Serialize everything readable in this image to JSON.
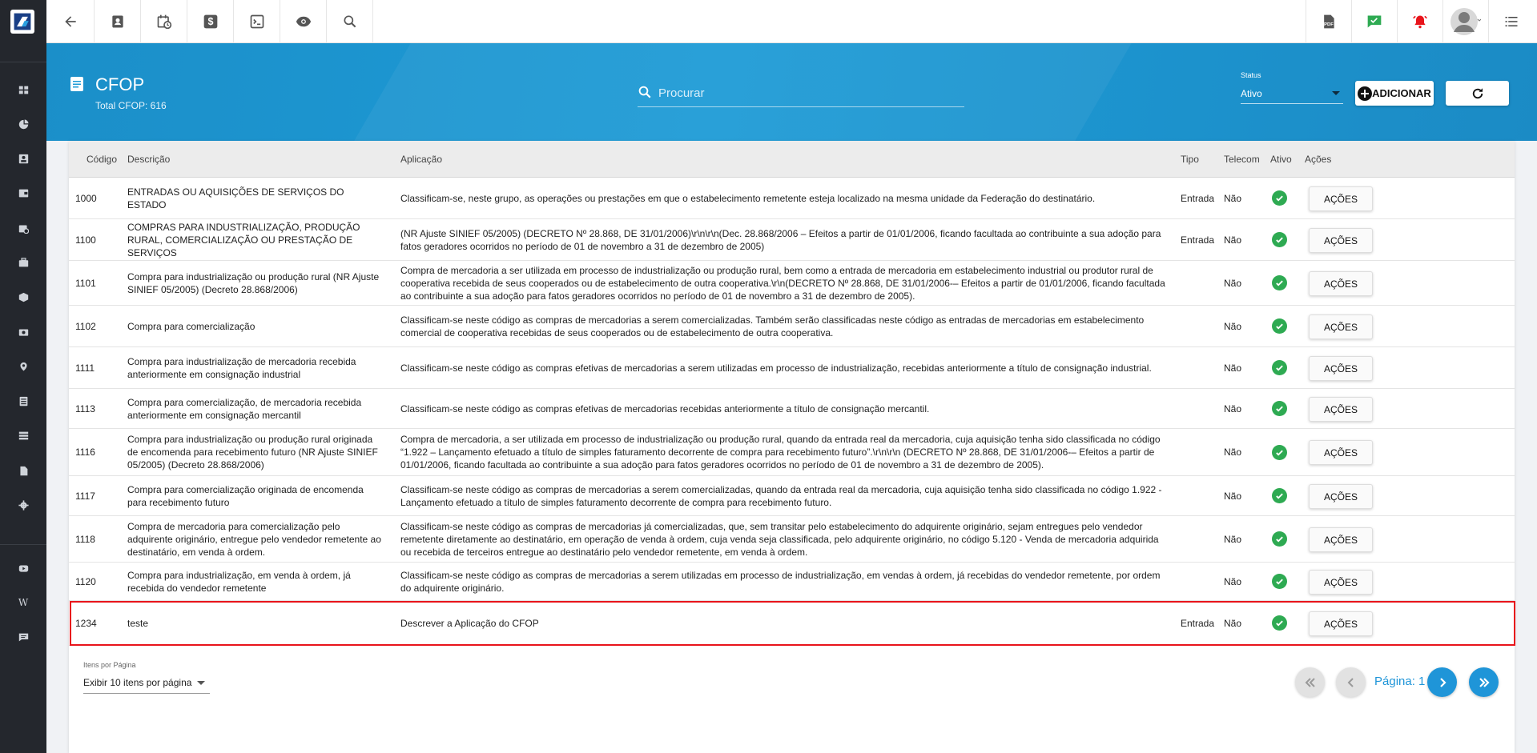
{
  "page": {
    "title": "CFOP",
    "total": "Total CFOP: 616"
  },
  "search": {
    "placeholder": "Procurar"
  },
  "status": {
    "label": "Status",
    "value": "Ativo"
  },
  "buttons": {
    "add": "ADICIONAR",
    "actions": "AÇÕES"
  },
  "table": {
    "headers": {
      "codigo": "Código",
      "descricao": "Descrição",
      "aplicacao": "Aplicação",
      "tipo": "Tipo",
      "telecom": "Telecom",
      "ativo": "Ativo",
      "acoes": "Ações"
    },
    "rows": [
      {
        "codigo": "1000",
        "descricao": "ENTRADAS OU AQUISIÇÕES DE SERVIÇOS DO ESTADO",
        "aplicacao": "Classificam-se, neste grupo, as operações ou prestações em que o estabelecimento remetente esteja localizado na mesma unidade da Federação do destinatário.",
        "tipo": "Entrada",
        "telecom": "Não"
      },
      {
        "codigo": "1100",
        "descricao": "COMPRAS PARA INDUSTRIALIZAÇÃO, PRODUÇÃO RURAL, COMERCIALIZAÇÃO OU PRESTAÇÃO DE SERVIÇOS",
        "aplicacao": "(NR Ajuste SINIEF 05/2005) (DECRETO Nº 28.868, DE 31/01/2006)\\r\\n\\r\\n(Dec. 28.868/2006 – Efeitos a partir de 01/01/2006, ficando facultada ao contribuinte a sua adoção para fatos geradores ocorridos no período de 01 de novembro a 31 de dezembro de 2005)",
        "tipo": "Entrada",
        "telecom": "Não"
      },
      {
        "codigo": "1101",
        "descricao": "Compra para industrialização ou produção rural (NR Ajuste SINIEF 05/2005) (Decreto 28.868/2006)",
        "aplicacao": "Compra de mercadoria a ser utilizada em processo de industrialização ou produção rural, bem como a entrada de mercadoria em estabelecimento industrial ou produtor rural de cooperativa recebida de seus cooperados ou de estabelecimento de outra cooperativa.\\r\\n(DECRETO Nº 28.868, DE 31/01/2006-– Efeitos a partir de 01/01/2006, ficando facultada ao contribuinte a sua adoção para fatos geradores ocorridos no período de 01 de novembro a 31 de dezembro de 2005).",
        "tipo": "",
        "telecom": "Não"
      },
      {
        "codigo": "1102",
        "descricao": "Compra para comercialização",
        "aplicacao": "Classificam-se neste código as compras de mercadorias a serem comercializadas. Também serão classificadas neste código as entradas de mercadorias em estabelecimento comercial de cooperativa recebidas de seus cooperados ou de estabelecimento de outra cooperativa.",
        "tipo": "",
        "telecom": "Não"
      },
      {
        "codigo": "1111",
        "descricao": "Compra para industrialização de mercadoria recebida anteriormente em consignação industrial",
        "aplicacao": "Classificam-se neste código as compras efetivas de mercadorias a serem utilizadas em processo de industrialização, recebidas anteriormente a título de consignação industrial.",
        "tipo": "",
        "telecom": "Não"
      },
      {
        "codigo": "1113",
        "descricao": "Compra para comercialização, de mercadoria recebida anteriormente em consignação mercantil",
        "aplicacao": "Classificam-se neste código as compras efetivas de mercadorias recebidas anteriormente a título de consignação mercantil.",
        "tipo": "",
        "telecom": "Não"
      },
      {
        "codigo": "1116",
        "descricao": "Compra para industrialização ou produção rural originada de encomenda para recebimento futuro (NR Ajuste SINIEF 05/2005) (Decreto 28.868/2006)",
        "aplicacao": "Compra de mercadoria, a ser utilizada em processo de industrialização ou produção rural, quando da entrada real da mercadoria, cuja aquisição tenha sido classificada no código “1.922 – Lançamento efetuado a título de simples faturamento decorrente de compra para recebimento futuro”.\\r\\n\\r\\n (DECRETO Nº 28.868, DE 31/01/2006-– Efeitos a partir de 01/01/2006, ficando facultada ao contribuinte a sua adoção para fatos geradores ocorridos no período de 01 de novembro a 31 de dezembro de 2005).",
        "tipo": "",
        "telecom": "Não"
      },
      {
        "codigo": "1117",
        "descricao": "Compra para comercialização originada de encomenda para recebimento futuro",
        "aplicacao": "Classificam-se neste código as compras de mercadorias a serem comercializadas, quando da entrada real da mercadoria, cuja aquisição tenha sido classificada no código 1.922 - Lançamento efetuado a título de simples faturamento decorrente de compra para recebimento futuro.",
        "tipo": "",
        "telecom": "Não"
      },
      {
        "codigo": "1118",
        "descricao": "Compra de mercadoria para comercialização pelo adquirente originário, entregue pelo vendedor remetente ao destinatário, em venda à ordem.",
        "aplicacao": "Classificam-se neste código as compras de mercadorias já comercializadas, que, sem transitar pelo estabelecimento do adquirente originário, sejam entregues pelo vendedor remetente diretamente ao destinatário, em operação de venda à ordem, cuja venda seja classificada, pelo adquirente originário, no código 5.120 - Venda de mercadoria adquirida ou recebida de terceiros entregue ao destinatário pelo vendedor remetente, em venda à ordem.",
        "tipo": "",
        "telecom": "Não"
      },
      {
        "codigo": "1120",
        "descricao": "Compra para industrialização, em venda à ordem, já recebida do vendedor remetente",
        "aplicacao": "Classificam-se neste código as compras de mercadorias a serem utilizadas em processo de industrialização, em vendas à ordem, já recebidas do vendedor remetente, por ordem do adquirente originário.",
        "tipo": "",
        "telecom": "Não"
      },
      {
        "codigo": "1234",
        "descricao": "teste",
        "aplicacao": "Descrever a Aplicação do CFOP",
        "tipo": "Entrada",
        "telecom": "Não"
      }
    ]
  },
  "pagination": {
    "items_label": "Itens por Página",
    "items_value": "Exibir 10 itens por página",
    "page_label": "Página: 1"
  },
  "colors": {
    "brand_blue": "#1e9bd6",
    "check_green": "#2eaa52",
    "highlight_red": "#e8141b",
    "sidebar": "#24272d"
  },
  "icons": {
    "top": [
      "back-arrow-icon",
      "contact-card-icon",
      "calendar-clock-icon",
      "dollar-icon",
      "terminal-icon",
      "eye-icon",
      "search-icon"
    ],
    "top_right": [
      "pdf-icon",
      "chat-check-icon",
      "alarm-bell-icon",
      "avatar",
      "list-menu-icon"
    ],
    "sidebar": [
      "dashboard-icon",
      "pie-chart-icon",
      "contact-icon",
      "wallet-icon",
      "calendar-icon",
      "briefcase-icon",
      "cube-icon",
      "money-icon",
      "location-icon",
      "document-list-icon",
      "server-icon",
      "file-icon",
      "gear-icon",
      "youtube-icon",
      "wikipedia-icon",
      "chat-icon"
    ]
  }
}
